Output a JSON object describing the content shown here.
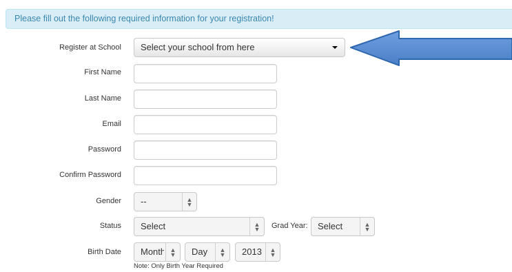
{
  "alert": {
    "text": "Please fill out the following required information for your registration!"
  },
  "form": {
    "school": {
      "label": "Register at School",
      "value": "Select your school from here"
    },
    "first_name": {
      "label": "First Name",
      "value": ""
    },
    "last_name": {
      "label": "Last Name",
      "value": ""
    },
    "email": {
      "label": "Email",
      "value": ""
    },
    "password": {
      "label": "Password",
      "value": ""
    },
    "confirm_password": {
      "label": "Confirm Password",
      "value": ""
    },
    "gender": {
      "label": "Gender",
      "value": "--"
    },
    "status": {
      "label": "Status",
      "value": "Select"
    },
    "grad_year": {
      "label": "Grad Year:",
      "value": "Select"
    },
    "birth_date": {
      "label": "Birth Date",
      "month": "Month",
      "day": "Day",
      "year": "2013",
      "note": "Note: Only Birth Year Required"
    }
  },
  "colors": {
    "alert_bg": "#d9edf7",
    "alert_text": "#3a87ad",
    "arrow_fill": "#5b8fd1",
    "arrow_stroke": "#2f66b0"
  },
  "icons": [
    "dropdown-caret-icon",
    "updown-arrows-icon",
    "left-arrow-pointer"
  ]
}
